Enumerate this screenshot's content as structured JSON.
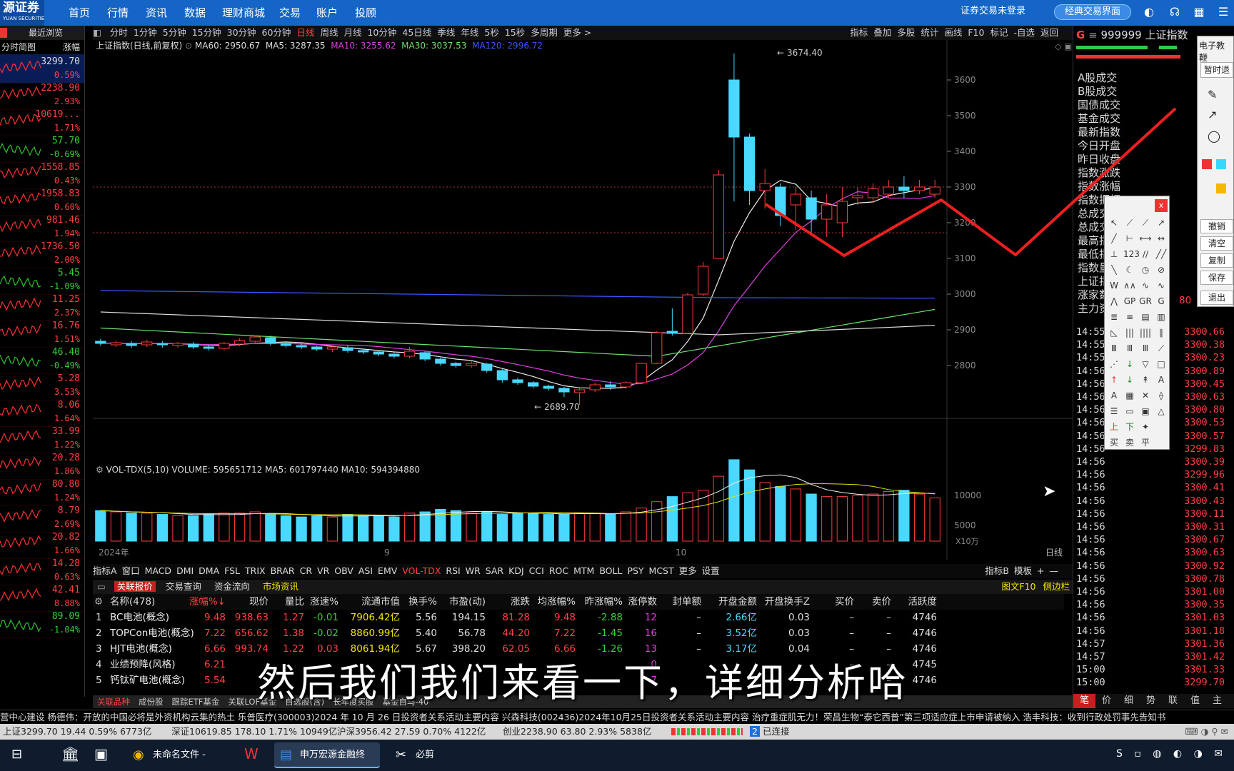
{
  "top": {
    "logo": "源证券",
    "logo_sub": "YUAN SECURITIES",
    "nav": [
      "首页",
      "行情",
      "资讯",
      "数据",
      "理财商城",
      "交易",
      "账户",
      "投顾"
    ],
    "login_status": "证券交易未登录",
    "classic_btn": "经典交易界面"
  },
  "left_panel": {
    "recent": "最近浏览",
    "col1": "分时简图",
    "col2": "涨幅",
    "items": [
      {
        "v": "3299.70",
        "p": "0.59%",
        "up": true
      },
      {
        "v": "2238.90",
        "p": "2.93%",
        "up": true
      },
      {
        "v": "10619...",
        "p": "1.71%",
        "up": true
      },
      {
        "v": "57.70",
        "p": "-0.69%",
        "up": false
      },
      {
        "v": "1558.85",
        "p": "0.43%",
        "up": true
      },
      {
        "v": "1958.83",
        "p": "0.60%",
        "up": true
      },
      {
        "v": "981.46",
        "p": "1.94%",
        "up": true
      },
      {
        "v": "1736.50",
        "p": "2.00%",
        "up": true
      },
      {
        "v": "5.45",
        "p": "-1.09%",
        "up": false
      },
      {
        "v": "11.25",
        "p": "2.37%",
        "up": true
      },
      {
        "v": "16.76",
        "p": "1.51%",
        "up": true
      },
      {
        "v": "46.40",
        "p": "-0.49%",
        "up": false
      },
      {
        "v": "5.28",
        "p": "3.53%",
        "up": true
      },
      {
        "v": "8.06",
        "p": "1.64%",
        "up": true
      },
      {
        "v": "33.99",
        "p": "1.22%",
        "up": true
      },
      {
        "v": "20.28",
        "p": "1.86%",
        "up": true
      },
      {
        "v": "80.80",
        "p": "1.24%",
        "up": true
      },
      {
        "v": "8.79",
        "p": "2.69%",
        "up": true
      },
      {
        "v": "20.82",
        "p": "1.66%",
        "up": true
      },
      {
        "v": "14.28",
        "p": "0.63%",
        "up": true
      },
      {
        "v": "42.41",
        "p": "8.88%",
        "up": true
      },
      {
        "v": "89.09",
        "p": "-1.04%",
        "up": false
      }
    ]
  },
  "periods": [
    "分时",
    "1分钟",
    "5分钟",
    "15分钟",
    "30分钟",
    "60分钟",
    "日线",
    "周线",
    "月线",
    "10分钟",
    "45日线",
    "季线",
    "年线",
    "5秒",
    "15秒",
    "多周期",
    "更多 >"
  ],
  "period_active": "日线",
  "chart_tools": [
    "指标",
    "叠加",
    "多股",
    "统计",
    "画线",
    "F10",
    "标记",
    "-自选",
    "返回"
  ],
  "legend": {
    "title": "上证指数(日线,前复权)",
    "ma60": "MA60: 2950.67",
    "ma5": "MA5: 3287.35",
    "ma10": "MA10: 3255.62",
    "ma30": "MA30: 3037.53",
    "ma120": "MA120: 2996.72"
  },
  "vol_legend": "VOL-TDX(5,10)  VOLUME: 595651712  MA5: 601797440  MA10: 594394880",
  "chart_data": {
    "type": "candlestick",
    "y_ticks": [
      3600,
      3500,
      3400,
      3300,
      3200,
      3100,
      3000,
      2900,
      2800
    ],
    "ylim": [
      2660,
      3700
    ],
    "vol_ticks": [
      "10000",
      "5000"
    ],
    "vol_unit": "X10万",
    "x_labels": [
      "2024年",
      "9",
      "10"
    ],
    "high_label": "3674.40",
    "low_label": "2689.70",
    "axis_label": "日线",
    "candles": [
      [
        2868,
        2862,
        2875,
        2855
      ],
      [
        2858,
        2864,
        2870,
        2852
      ],
      [
        2862,
        2856,
        2868,
        2850
      ],
      [
        2858,
        2866,
        2872,
        2852
      ],
      [
        2862,
        2858,
        2868,
        2850
      ],
      [
        2856,
        2862,
        2866,
        2850
      ],
      [
        2860,
        2852,
        2866,
        2846
      ],
      [
        2852,
        2848,
        2858,
        2842
      ],
      [
        2848,
        2862,
        2866,
        2842
      ],
      [
        2860,
        2870,
        2876,
        2854
      ],
      [
        2868,
        2880,
        2884,
        2862
      ],
      [
        2878,
        2862,
        2884,
        2856
      ],
      [
        2862,
        2856,
        2866,
        2850
      ],
      [
        2856,
        2852,
        2862,
        2846
      ],
      [
        2852,
        2846,
        2856,
        2840
      ],
      [
        2846,
        2852,
        2856,
        2838
      ],
      [
        2850,
        2842,
        2856,
        2836
      ],
      [
        2842,
        2838,
        2846,
        2832
      ],
      [
        2838,
        2832,
        2842,
        2826
      ],
      [
        2832,
        2826,
        2836,
        2820
      ],
      [
        2826,
        2840,
        2852,
        2820
      ],
      [
        2836,
        2818,
        2840,
        2812
      ],
      [
        2818,
        2806,
        2822,
        2800
      ],
      [
        2806,
        2800,
        2810,
        2794
      ],
      [
        2800,
        2806,
        2812,
        2794
      ],
      [
        2804,
        2786,
        2808,
        2780
      ],
      [
        2786,
        2760,
        2790,
        2752
      ],
      [
        2760,
        2752,
        2766,
        2746
      ],
      [
        2752,
        2742,
        2756,
        2736
      ],
      [
        2742,
        2736,
        2746,
        2730
      ],
      [
        2736,
        2726,
        2740,
        2712
      ],
      [
        2724,
        2732,
        2740,
        2690
      ],
      [
        2732,
        2746,
        2752,
        2726
      ],
      [
        2746,
        2740,
        2756,
        2732
      ],
      [
        2740,
        2752,
        2756,
        2734
      ],
      [
        2752,
        2806,
        2808,
        2748
      ],
      [
        2806,
        2892,
        2896,
        2804
      ],
      [
        2896,
        2890,
        2960,
        2884
      ],
      [
        2890,
        2998,
        3004,
        2888
      ],
      [
        3000,
        3078,
        3090,
        2994
      ],
      [
        3100,
        3334,
        3348,
        3152
      ],
      [
        3600,
        3440,
        3674,
        3260
      ],
      [
        3440,
        3290,
        3450,
        3250
      ],
      [
        3290,
        3310,
        3350,
        3240
      ],
      [
        3300,
        3220,
        3310,
        3190
      ],
      [
        3250,
        3280,
        3300,
        3180
      ],
      [
        3270,
        3210,
        3290,
        3170
      ],
      [
        3210,
        3250,
        3280,
        3160
      ],
      [
        3200,
        3260,
        3300,
        3160
      ],
      [
        3270,
        3276,
        3300,
        3250
      ],
      [
        3270,
        3295,
        3310,
        3255
      ],
      [
        3280,
        3300,
        3320,
        3270
      ],
      [
        3300,
        3290,
        3330,
        3270
      ],
      [
        3290,
        3300,
        3320,
        3280
      ],
      [
        3280,
        3300,
        3320,
        3270
      ]
    ],
    "volumes": [
      48,
      46,
      44,
      44,
      42,
      40,
      40,
      42,
      44,
      44,
      46,
      42,
      40,
      38,
      40,
      38,
      42,
      40,
      40,
      38,
      44,
      46,
      50,
      48,
      44,
      46,
      42,
      44,
      44,
      42,
      42,
      44,
      44,
      42,
      46,
      52,
      62,
      70,
      76,
      80,
      102,
      128,
      112,
      92,
      86,
      82,
      74,
      70,
      70,
      72,
      74,
      78,
      80,
      74,
      68
    ]
  },
  "indicator_tabs": [
    "指标A",
    "窗口",
    "MACD",
    "DMI",
    "DMA",
    "FSL",
    "TRIX",
    "BRAR",
    "CR",
    "VR",
    "OBV",
    "ASI",
    "EMV",
    "VOL-TDX",
    "RSI",
    "WR",
    "SAR",
    "KDJ",
    "CCI",
    "ROC",
    "MTM",
    "BOLL",
    "PSY",
    "MCST",
    "更多",
    "设置"
  ],
  "indicator_active": "VOL-TDX",
  "indicator_right": [
    "指标B",
    "模板",
    "+",
    "—"
  ],
  "table_tabs": [
    "关联报价",
    "交易查询",
    "资金流向",
    "市场资讯"
  ],
  "table_right": [
    "图文F10",
    "侧边栏"
  ],
  "table": {
    "headers": [
      "名称(478)",
      "",
      "涨幅%↓",
      "现价",
      "量比",
      "涨速%",
      "流通市值",
      "换手%",
      "市盈(动)",
      "涨跌",
      "均涨幅%",
      "昨涨幅%",
      "涨停数",
      "封单额",
      "开盘金额",
      "开盘换手Z",
      "买价",
      "卖价",
      "活跃度"
    ],
    "rows": [
      [
        "1",
        "BC电池(概念)",
        "9.48",
        "938.63",
        "1.27",
        "-0.01",
        "7906.42亿",
        "5.56",
        "194.15",
        "81.28",
        "9.48",
        "-2.88",
        "12",
        "–",
        "2.66亿",
        "0.03",
        "–",
        "–",
        "4746"
      ],
      [
        "2",
        "TOPCon电池(概念)",
        "7.22",
        "656.62",
        "1.38",
        "-0.02",
        "8860.99亿",
        "5.40",
        "56.78",
        "44.20",
        "7.22",
        "-1.45",
        "16",
        "–",
        "3.52亿",
        "0.03",
        "–",
        "–",
        "4746"
      ],
      [
        "3",
        "HJT电池(概念)",
        "6.66",
        "993.74",
        "1.22",
        "0.03",
        "8061.94亿",
        "5.67",
        "398.20",
        "62.05",
        "6.66",
        "-1.26",
        "13",
        "–",
        "3.17亿",
        "0.04",
        "–",
        "–",
        "4746"
      ],
      [
        "4",
        "业绩预降(风格)",
        "6.21",
        "",
        "",
        "",
        "",
        "",
        "",
        "",
        "",
        "",
        "0",
        "",
        "",
        "",
        "–",
        "–",
        "4745"
      ],
      [
        "5",
        "钙钛矿电池(概念)",
        "5.54",
        "",
        "",
        "",
        "",
        "",
        "",
        "",
        "",
        "",
        "7",
        "",
        "",
        "",
        "–",
        "–",
        "4746"
      ]
    ]
  },
  "bottom_tabs": [
    "关联品种",
    "成份股",
    "跟踪ETF基金",
    "关联LOF基金",
    "自选股(含)",
    "长年度买股",
    "基金自马-40"
  ],
  "right_panel": {
    "code": "999999",
    "name": "上证指数",
    "labels": [
      "A股成交",
      "B股成交",
      "国债成交",
      "基金成交",
      "最新指数",
      "今日开盘",
      "昨日收盘",
      "指数涨跌",
      "指数涨幅",
      "指数振幅",
      "总成交额",
      "总成交量",
      "最高指数",
      "最低指数",
      "指数量比",
      "上证指数",
      "涨家数",
      "主力资金"
    ],
    "ticks": [
      [
        "14:55",
        "3300.66"
      ],
      [
        "14:55",
        "3300.38"
      ],
      [
        "14:55",
        "3300.23"
      ],
      [
        "14:56",
        "3300.89"
      ],
      [
        "14:56",
        "3300.45"
      ],
      [
        "14:56",
        "3300.63"
      ],
      [
        "14:56",
        "3300.80"
      ],
      [
        "14:56",
        "3300.53"
      ],
      [
        "14:56",
        "3300.57"
      ],
      [
        "14:56",
        "3299.83"
      ],
      [
        "14:56",
        "3300.39"
      ],
      [
        "14:56",
        "3299.96"
      ],
      [
        "14:56",
        "3300.41"
      ],
      [
        "14:56",
        "3300.43"
      ],
      [
        "14:56",
        "3300.11"
      ],
      [
        "14:56",
        "3300.31"
      ],
      [
        "14:56",
        "3300.67"
      ],
      [
        "14:56",
        "3300.63"
      ],
      [
        "14:56",
        "3300.92"
      ],
      [
        "14:56",
        "3300.78"
      ],
      [
        "14:56",
        "3301.00"
      ],
      [
        "14:56",
        "3300.35"
      ],
      [
        "14:56",
        "3301.03"
      ],
      [
        "14:56",
        "3301.18"
      ],
      [
        "14:57",
        "3301.36"
      ],
      [
        "14:57",
        "3301.42"
      ],
      [
        "15:00",
        "3301.33"
      ],
      [
        "15:00",
        "3299.70"
      ]
    ],
    "bottom_tabs": [
      "笔",
      "价",
      "细",
      "势",
      "联",
      "值",
      "主"
    ],
    "partial_value": "80"
  },
  "side_menu": {
    "title": "电子教鞭",
    "items": [
      "暂时退",
      "撤销",
      "清空",
      "复制",
      "保存",
      "退出"
    ]
  },
  "ticker": "营中心建设    杨德伟：开放的中国必将是外资机构云集的热土    乐普医疗(300003)2024 年 10 月 26 日投资者关系活动主要内容    兴森科技(002436)2024年10月25日投资者关系活动主要内容    治疗重症肌无力！荣昌生物“泰它西普”第三项适应症上市申请被纳入    浩丰科技：收到行政处罚事先告知书",
  "status": {
    "sh": "上证3299.70   19.44  0.59%  6773亿",
    "sz": "深证10619.85 178.10  1.71%  10949亿",
    "hs": "沪深3956.42   27.59  0.70%  4122亿",
    "cy": "创业2238.90   63.80  2.93%  5838亿",
    "conn": "已连接"
  },
  "taskbar": {
    "apps": [
      "未命名文件 - boar...",
      "申万宏源金融终端...",
      "必剪"
    ]
  },
  "subtitle": "然后我们我们来看一下，详细分析哈"
}
